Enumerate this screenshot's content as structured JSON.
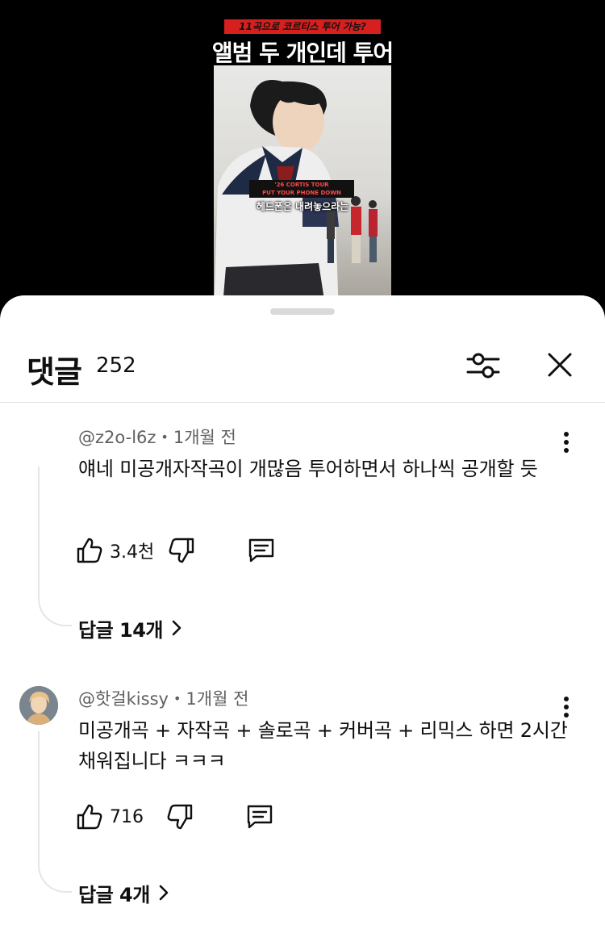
{
  "video": {
    "banner": "11곡으로 코르티스 투어 가능?",
    "title": "앨범 두 개인데 투어",
    "tag_line1": "'26 CORTIS TOUR",
    "tag_line2": "PUT YOUR PHONE DOWN",
    "caption": "헤드폰은 내려놓으라는"
  },
  "comments_header": {
    "title": "댓글",
    "count": "252"
  },
  "comments": [
    {
      "author": "@z2o-l6z",
      "time": "1개월 전",
      "text": "얘네 미공개자작곡이 개많음 투어하면서 하나씩 공개할 듯",
      "likes": "3.4천",
      "replies": "답글 14개"
    },
    {
      "author": "@핫걸kissy",
      "time": "1개월 전",
      "text": "미공개곡 + 자작곡 + 솔로곡 + 커버곡 + 리믹스 하면 2시간 채워집니다 ㅋㅋㅋ",
      "likes": "716",
      "replies": "답글 4개"
    }
  ],
  "icons": [
    "filter-icon",
    "close-icon",
    "more-vert-icon",
    "thumb-up-icon",
    "thumb-down-icon",
    "reply-icon",
    "chevron-right-icon"
  ]
}
